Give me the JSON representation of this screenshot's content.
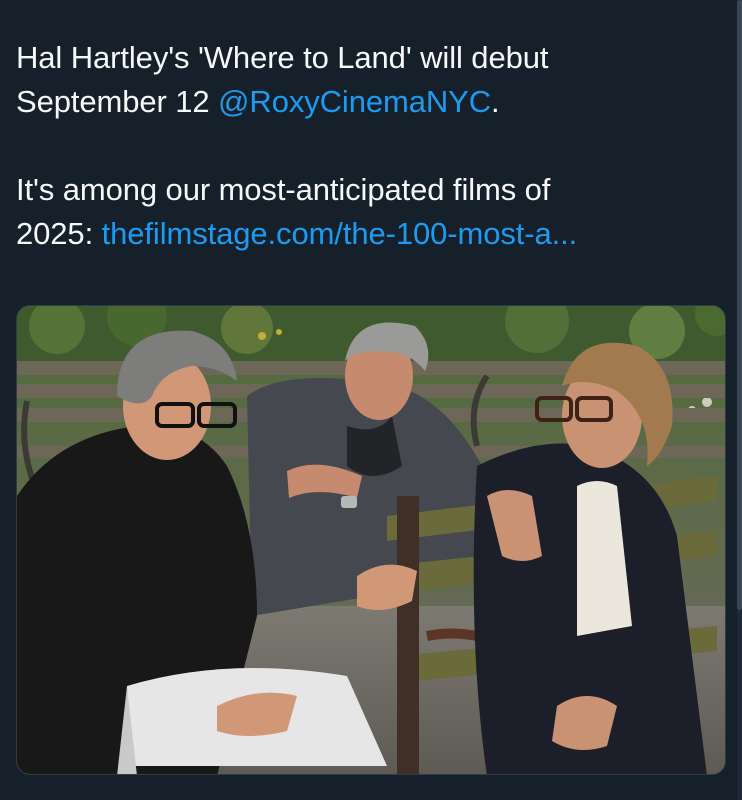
{
  "tweet": {
    "line1": "Hal Hartley's 'Where to Land' will debut",
    "line2_prefix": "September 12 ",
    "mention": "@RoxyCinemaNYC",
    "line2_suffix": ".",
    "line3": "It's among our most-anticipated films of",
    "line4_prefix": "2025: ",
    "link": "thefilmstage.com/the-100-most-a..."
  },
  "colors": {
    "background": "#15202b",
    "text": "#f7f9f9",
    "link": "#1d9bf0"
  },
  "media": {
    "type": "photo"
  }
}
